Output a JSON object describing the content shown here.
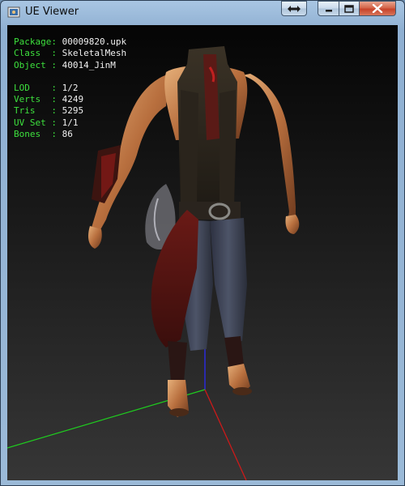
{
  "window": {
    "title": "UE Viewer"
  },
  "titlebar_buttons": [
    {
      "name": "swap-button",
      "icon": "double-arrow-icon"
    },
    {
      "name": "minimize-button",
      "icon": "minimize-icon"
    },
    {
      "name": "maximize-button",
      "icon": "maximize-icon"
    },
    {
      "name": "close-button",
      "icon": "close-x-icon"
    }
  ],
  "info": {
    "package": {
      "label": "Package:",
      "value": "00009820.upk"
    },
    "class": {
      "label": "Class  :",
      "value": "SkeletalMesh"
    },
    "object": {
      "label": "Object :",
      "value": "40014_JinM"
    },
    "lod": {
      "label": "LOD    :",
      "value": "1/2"
    },
    "verts": {
      "label": "Verts  :",
      "value": "4249"
    },
    "tris": {
      "label": "Tris   :",
      "value": "5295"
    },
    "uvset": {
      "label": "UV Set :",
      "value": "1/1"
    },
    "bones": {
      "label": "Bones  :",
      "value": "86"
    }
  },
  "colors": {
    "info_label": "#3de03d",
    "info_value": "#f0f0f0",
    "axis_x": "#cc1a1a",
    "axis_y": "#1fcc1f",
    "axis_z": "#2a2ad8"
  }
}
